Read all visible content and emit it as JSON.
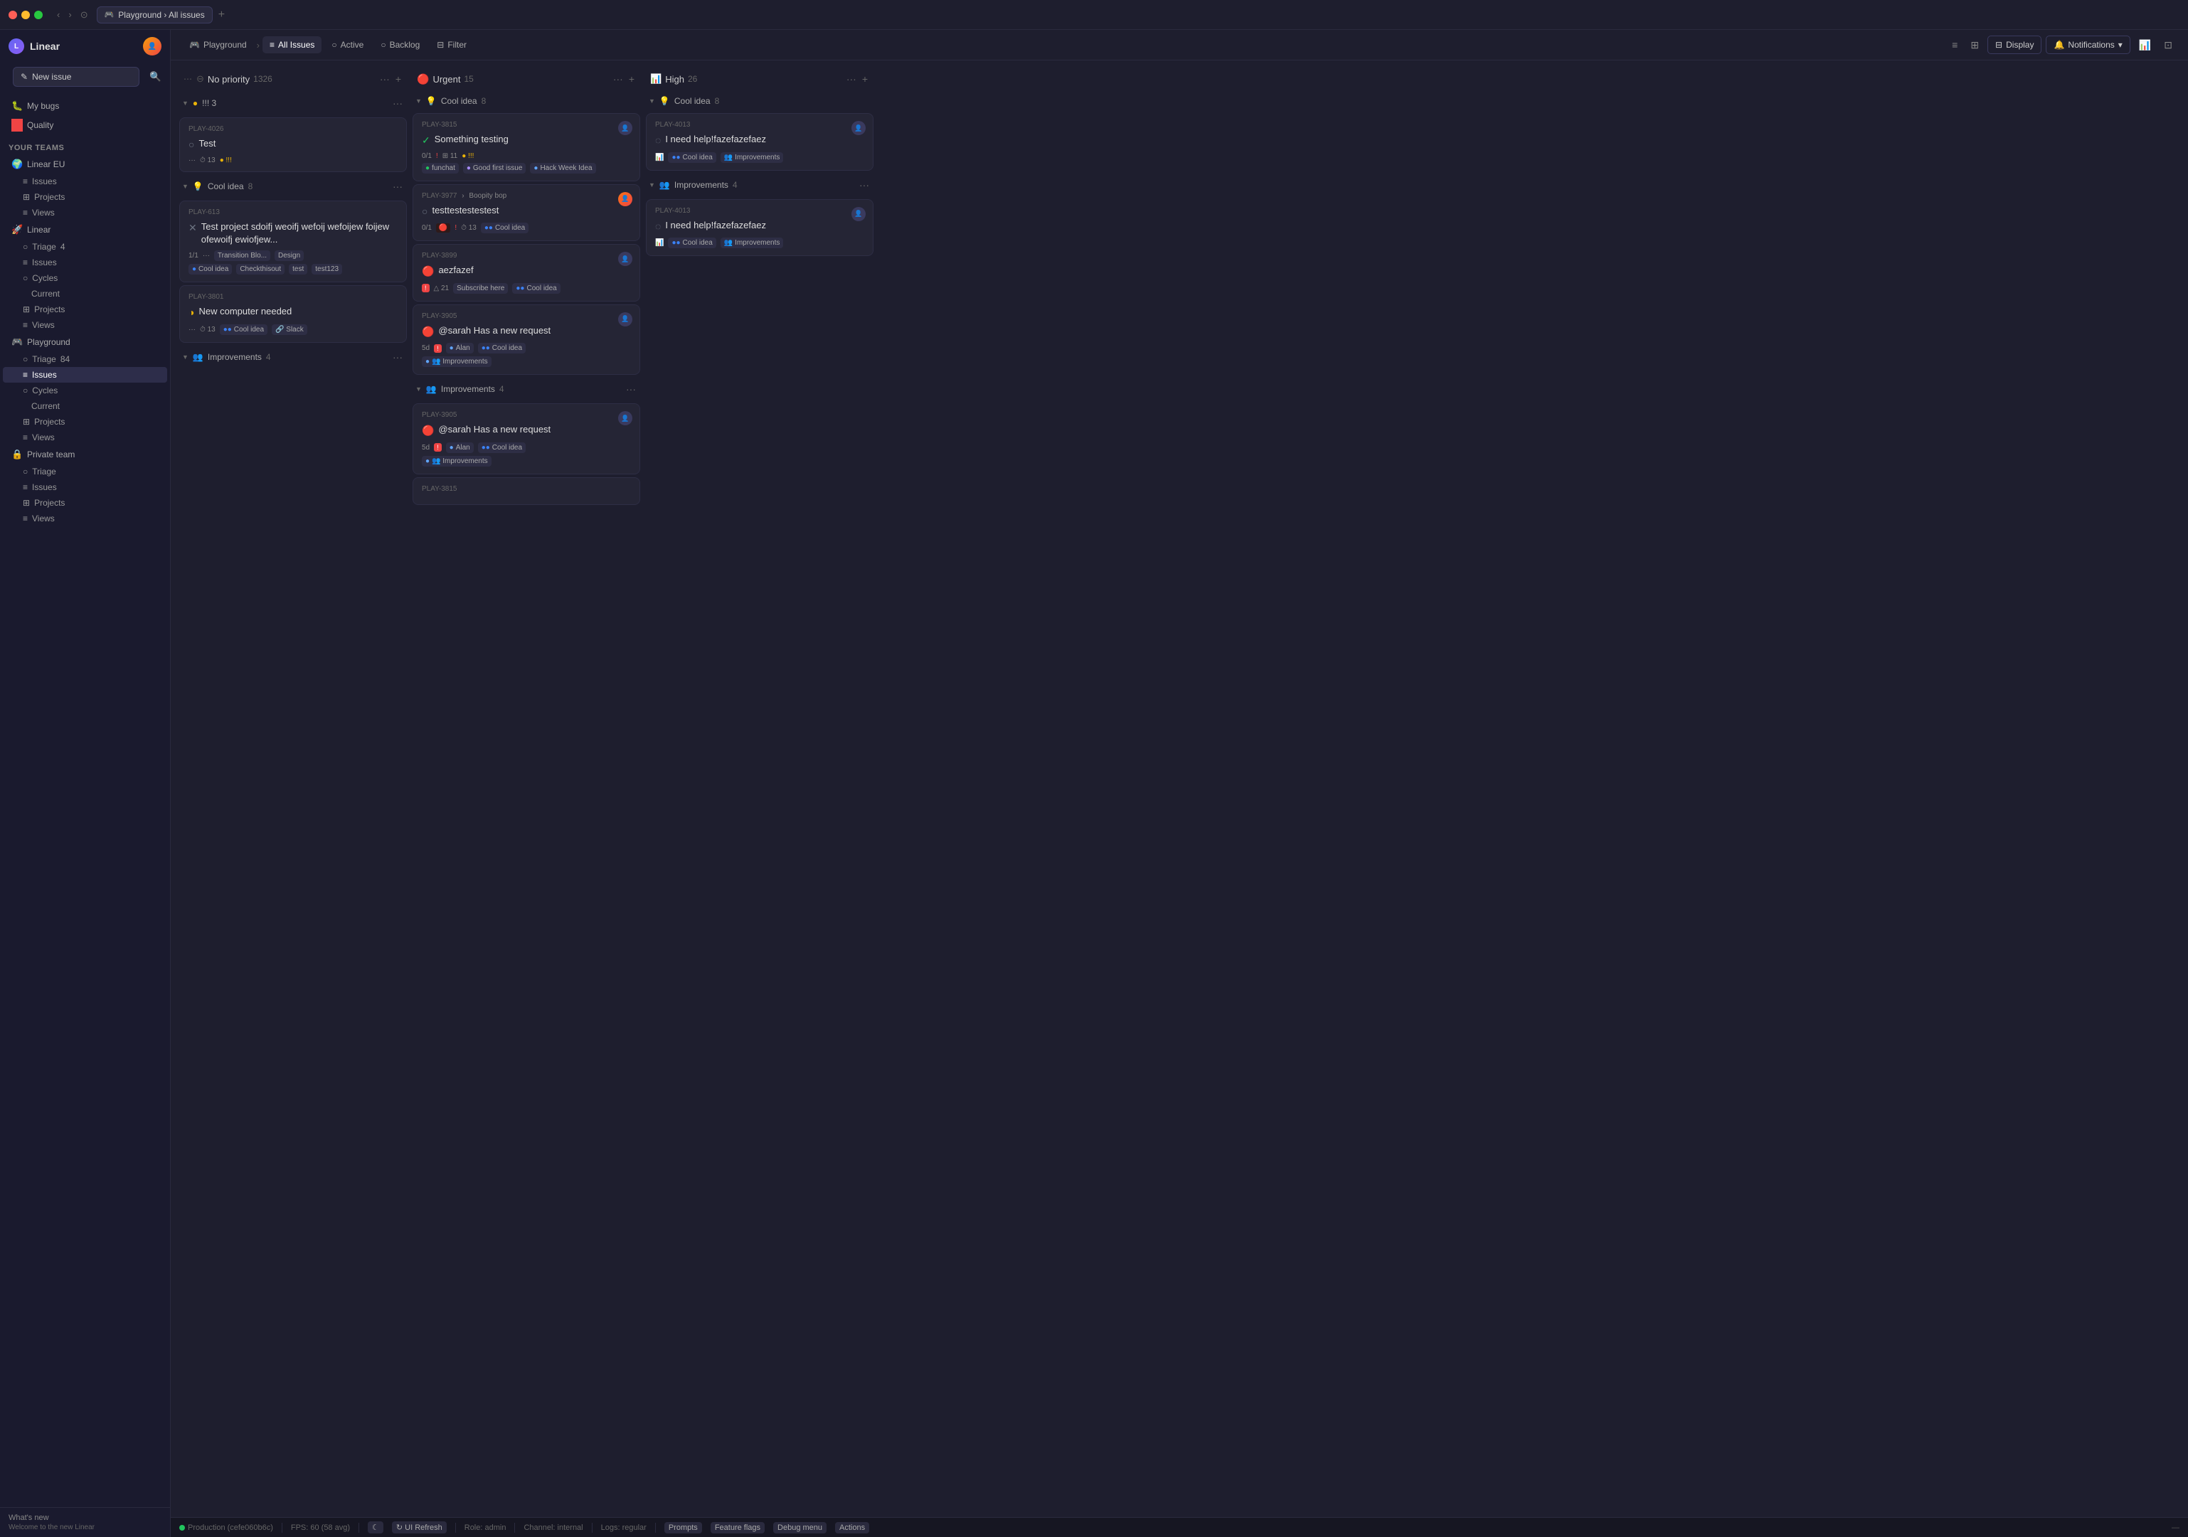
{
  "titleBar": {
    "tabLabel": "Playground › All issues",
    "tabIcon": "🎮"
  },
  "sidebar": {
    "brand": "Linear",
    "brandIcon": "L",
    "newIssueLabel": "New issue",
    "searchIcon": "🔍",
    "pinnedItems": [
      {
        "label": "My bugs",
        "icon": "🐛"
      },
      {
        "label": "Quality",
        "icon": "●"
      }
    ],
    "teamsLabel": "Your teams",
    "teams": [
      {
        "name": "Linear EU",
        "icon": "🌍",
        "color": "blue",
        "items": [
          {
            "label": "Issues",
            "icon": "≡"
          },
          {
            "label": "Projects",
            "icon": "⊞"
          },
          {
            "label": "Views",
            "icon": "≡"
          }
        ]
      },
      {
        "name": "Linear",
        "icon": "🚀",
        "color": "purple",
        "items": [
          {
            "label": "Triage",
            "icon": "○",
            "badge": "4"
          },
          {
            "label": "Issues",
            "icon": "≡"
          },
          {
            "label": "Cycles",
            "icon": "○"
          },
          {
            "label": "Current",
            "icon": ""
          },
          {
            "label": "Projects",
            "icon": "⊞"
          },
          {
            "label": "Views",
            "icon": "≡"
          }
        ]
      },
      {
        "name": "Playground",
        "icon": "🎮",
        "color": "orange",
        "items": [
          {
            "label": "Triage",
            "icon": "○",
            "badge": "84"
          },
          {
            "label": "Issues",
            "icon": "≡",
            "active": true
          },
          {
            "label": "Cycles",
            "icon": "○"
          },
          {
            "label": "Current",
            "icon": ""
          },
          {
            "label": "Projects",
            "icon": "⊞"
          },
          {
            "label": "Views",
            "icon": "≡"
          }
        ]
      },
      {
        "name": "Private team",
        "icon": "🔒",
        "color": "red",
        "items": [
          {
            "label": "Triage",
            "icon": "○"
          },
          {
            "label": "Issues",
            "icon": "≡"
          },
          {
            "label": "Projects",
            "icon": "⊞"
          },
          {
            "label": "Views",
            "icon": "≡"
          }
        ]
      }
    ],
    "whatsNew": "What's new",
    "whatsNewSub": "Welcome to the new Linear"
  },
  "toolbar": {
    "breadcrumb": "Playground",
    "breadcrumbSep": "›",
    "tabs": [
      {
        "label": "All Issues",
        "icon": "≡",
        "active": true
      },
      {
        "label": "Active",
        "icon": "○"
      },
      {
        "label": "Backlog",
        "icon": "○"
      }
    ],
    "filterLabel": "Filter",
    "displayLabel": "Display",
    "notificationsLabel": "Notifications"
  },
  "board": {
    "columns": [
      {
        "id": "no-priority",
        "title": "No priority",
        "count": 1326,
        "priority_icon": "⋯",
        "groups": [
          {
            "name": "!!! 3",
            "collapse": true,
            "cards": [
              {
                "id": "PLAY-4026",
                "title": "Test",
                "status": "todo",
                "statusIcon": "○",
                "meta": [
                  "··· ",
                  "⏱ 13",
                  "● !!!"
                ]
              }
            ]
          },
          {
            "name": "Cool idea",
            "emoji": "💡",
            "count": 8,
            "cards": [
              {
                "id": "PLAY-613",
                "title": "Test project sdoifj weoifj wefoij wefoijew foijew ofewoifj ewiofjew...",
                "status": "cancelled",
                "statusIcon": "✕",
                "meta": [
                  "1/1",
                  "···",
                  "Transition Blo...",
                  "Design"
                ],
                "tags": [
                  "● Cool idea",
                  "Checkthisout",
                  "test",
                  "test123"
                ]
              },
              {
                "id": "PLAY-3801",
                "title": "New computer needed",
                "status": "inprogress",
                "statusIcon": "◑",
                "meta": [
                  "···",
                  "⏱ 13"
                ],
                "tags": [
                  "●● Cool idea",
                  "Slack"
                ]
              }
            ]
          },
          {
            "name": "Improvements",
            "emoji": "👥",
            "count": 4,
            "cards": []
          }
        ]
      },
      {
        "id": "urgent",
        "title": "Urgent",
        "count": 15,
        "priority_icon": "🔴",
        "groups": [
          {
            "name": "Cool idea",
            "emoji": "💡",
            "count": 8,
            "cards": [
              {
                "id": "PLAY-3815",
                "title": "Something testing",
                "status": "done",
                "statusIcon": "✓",
                "hasAvatar": true,
                "meta": [
                  "0/1",
                  "!",
                  "⊞ 11",
                  "● !!!"
                ],
                "tags": [
                  "funchat",
                  "Good first issue",
                  "Hack Week Idea"
                ]
              },
              {
                "id": "PLAY-3977",
                "parent": "Boopity bop",
                "title": "testtestestestest",
                "status": "todo",
                "statusIcon": "○",
                "hasAvatar": true,
                "meta": [
                  "0/1",
                  "🔴",
                  "!",
                  "⏱ 13"
                ],
                "tags": [
                  "●● Cool idea"
                ]
              },
              {
                "id": "PLAY-3899",
                "title": "aezfazef",
                "status": "urgent",
                "statusIcon": "🔴",
                "hasAvatar": true,
                "meta": [
                  "!",
                  "△ 21",
                  "Subscribe here"
                ],
                "tags": [
                  "●● Cool idea"
                ]
              },
              {
                "id": "PLAY-3905",
                "title": "@sarah Has a new request",
                "status": "urgent",
                "statusIcon": "🔴",
                "hasAvatar": true,
                "meta": [
                  "5d",
                  "!",
                  "Alan"
                ],
                "tags": [
                  "●● Cool idea",
                  "👥 Improvements"
                ]
              }
            ]
          },
          {
            "name": "Improvements",
            "emoji": "👥",
            "count": 4,
            "cards": [
              {
                "id": "PLAY-3905",
                "title": "@sarah Has a new request",
                "status": "urgent",
                "statusIcon": "🔴",
                "hasAvatar": true,
                "meta": [
                  "5d",
                  "!",
                  "Alan"
                ],
                "tags": [
                  "●● Cool idea",
                  "👥 Improvements"
                ]
              }
            ]
          }
        ]
      },
      {
        "id": "high",
        "title": "High",
        "count": 26,
        "priority_icon": "📊",
        "groups": [
          {
            "name": "Cool idea",
            "emoji": "💡",
            "count": 8,
            "cards": [
              {
                "id": "PLAY-4013",
                "title": "I need help!fazefazefaez",
                "status": "loading",
                "statusIcon": "◌",
                "hasAvatar": true,
                "meta": [
                  "📊"
                ],
                "tags": [
                  "●● Cool idea",
                  "👥 Improvements"
                ]
              }
            ]
          },
          {
            "name": "Improvements",
            "emoji": "👥",
            "count": 4,
            "cards": [
              {
                "id": "PLAY-4013",
                "title": "I need help!fazefazefaez",
                "status": "loading",
                "statusIcon": "◌",
                "hasAvatar": true,
                "meta": [
                  "📊"
                ],
                "tags": [
                  "●● Cool idea",
                  "👥 Improvements"
                ]
              }
            ]
          }
        ]
      }
    ]
  },
  "bottomBar": {
    "env": "Production (cefe060b6c)",
    "fps": "FPS: 60 (58 avg)",
    "role": "Role: admin",
    "channel": "Channel: internal",
    "logs": "Logs: regular",
    "prompts": "Prompts",
    "featureFlags": "Feature flags",
    "debugMenu": "Debug menu",
    "actions": "Actions"
  }
}
